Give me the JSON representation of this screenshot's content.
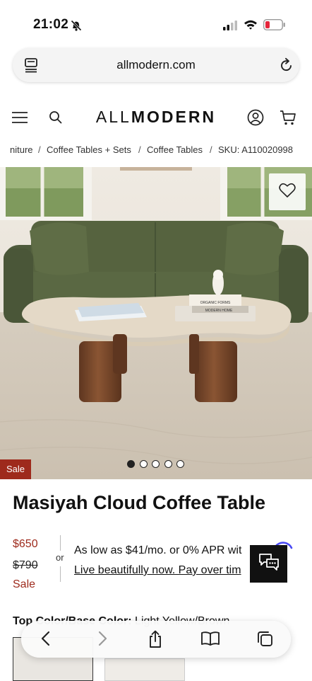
{
  "status_bar": {
    "time": "21:02"
  },
  "browser": {
    "url": "allmodern.com"
  },
  "header": {
    "logo_light": "ALL",
    "logo_bold": "MODERN"
  },
  "breadcrumb": {
    "items": [
      "niture",
      "Coffee Tables + Sets",
      "Coffee Tables",
      "SKU: A110020998"
    ],
    "separator": "/"
  },
  "hero": {
    "badge": "Sale",
    "image_count": 5,
    "active_index": 0,
    "book_labels": [
      "ORGANIC FORMS",
      "MODERN HOME"
    ]
  },
  "product": {
    "title": "Masiyah Cloud Coffee Table",
    "price_current": "$650",
    "price_original": "$790",
    "sale_label": "Sale",
    "or_label": "or",
    "financing_line1": "As low as $41/mo. or 0% APR wit",
    "financing_line2": "Live beautifully now. Pay over tim",
    "option_label": "Top Color/Base Color:",
    "option_value": "Light Yellow/Brown"
  },
  "colors": {
    "sale_red": "#9e2a1c",
    "sofa_green": "#4e5b3c",
    "wood_brown": "#7a4a2b"
  },
  "icons": [
    "bell-slash-icon",
    "signal-icon",
    "wifi-icon",
    "battery-icon",
    "tabs-icon",
    "reload-icon",
    "menu-icon",
    "search-icon",
    "account-icon",
    "cart-icon",
    "heart-icon",
    "chat-icon",
    "back-icon",
    "forward-icon",
    "share-icon",
    "bookmarks-icon",
    "tabs-overview-icon"
  ]
}
